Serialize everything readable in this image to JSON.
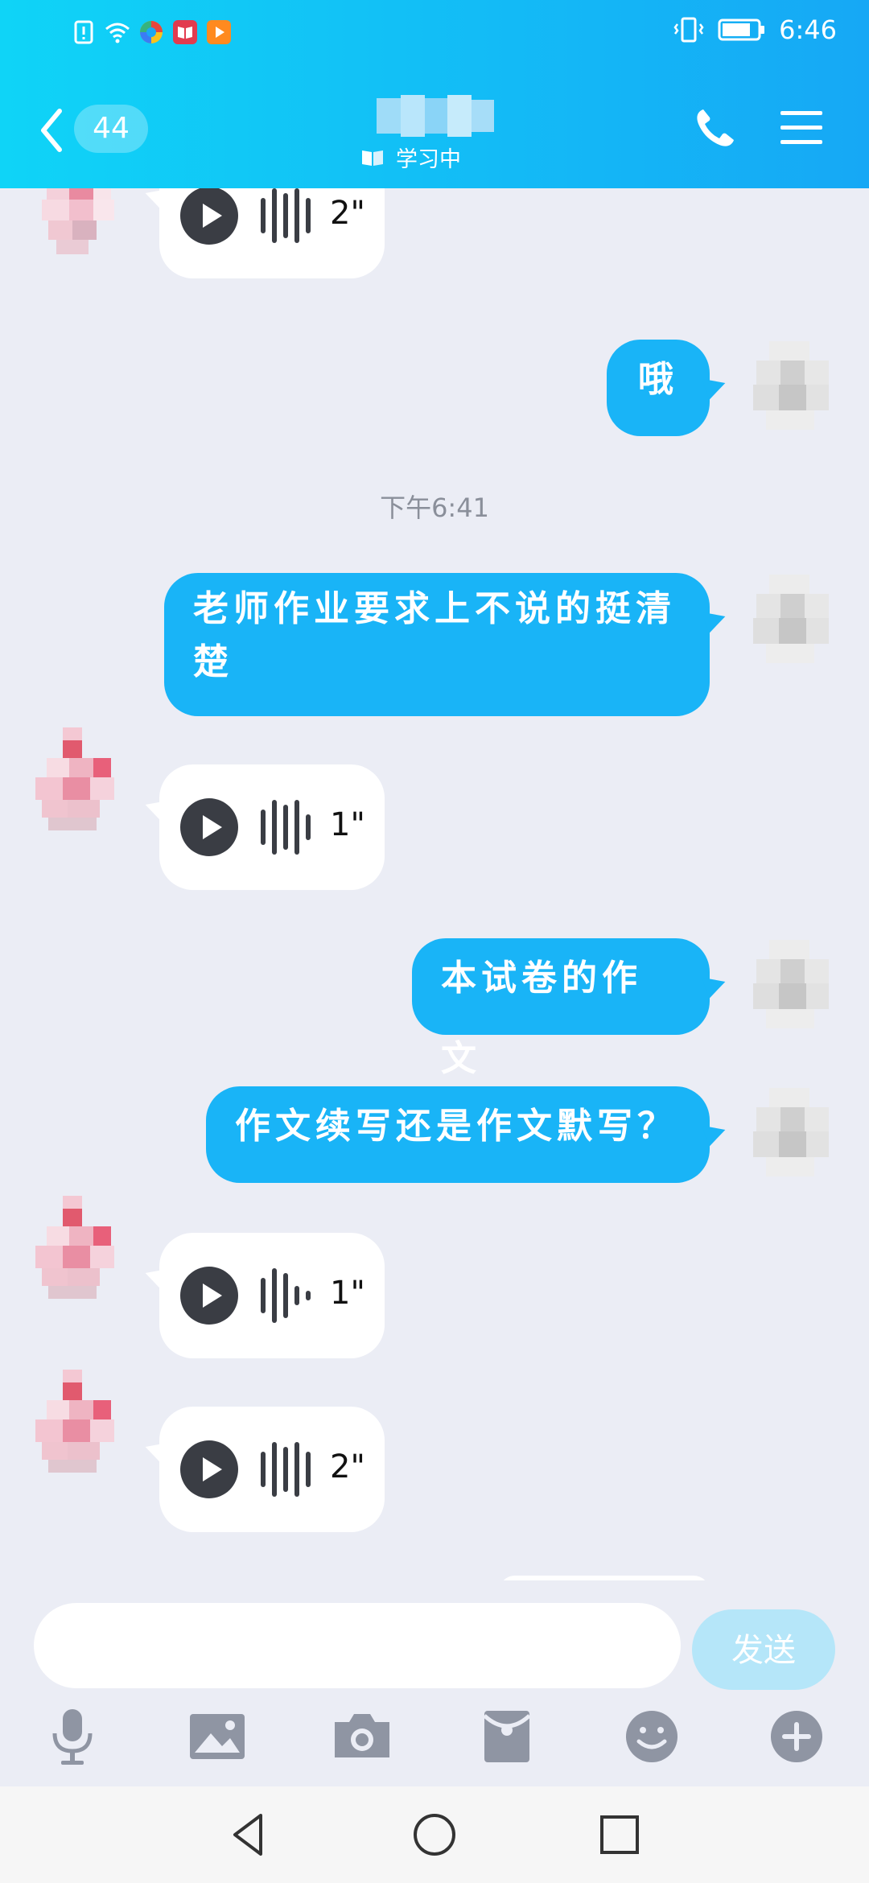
{
  "status_bar": {
    "time": "6:46"
  },
  "header": {
    "unread_count": "44",
    "subtitle": "学习中"
  },
  "chat": {
    "messages": [
      {
        "type": "voice",
        "from": "other",
        "duration": "2\""
      },
      {
        "type": "text",
        "from": "me",
        "text": "哦"
      },
      {
        "type": "timestamp",
        "text": "下午6:41"
      },
      {
        "type": "text",
        "from": "me",
        "text": "老师作业要求上不说的挺清楚"
      },
      {
        "type": "voice",
        "from": "other",
        "duration": "1\""
      },
      {
        "type": "text",
        "from": "me",
        "text": "本试卷的作文"
      },
      {
        "type": "text",
        "from": "me",
        "text": "作文续写还是作文默写？"
      },
      {
        "type": "voice",
        "from": "other",
        "duration": "1\""
      },
      {
        "type": "voice",
        "from": "other",
        "duration": "2\""
      }
    ]
  },
  "input": {
    "value": "",
    "send_label": "发送"
  },
  "toolbar": {
    "icons": [
      "microphone-icon",
      "image-icon",
      "camera-icon",
      "red-packet-icon",
      "emoji-icon",
      "plus-icon"
    ]
  },
  "colors": {
    "accent": "#19b4f7",
    "header_start": "#0fd4f7",
    "header_end": "#16a8f5",
    "chat_bg": "#ebedf5"
  }
}
